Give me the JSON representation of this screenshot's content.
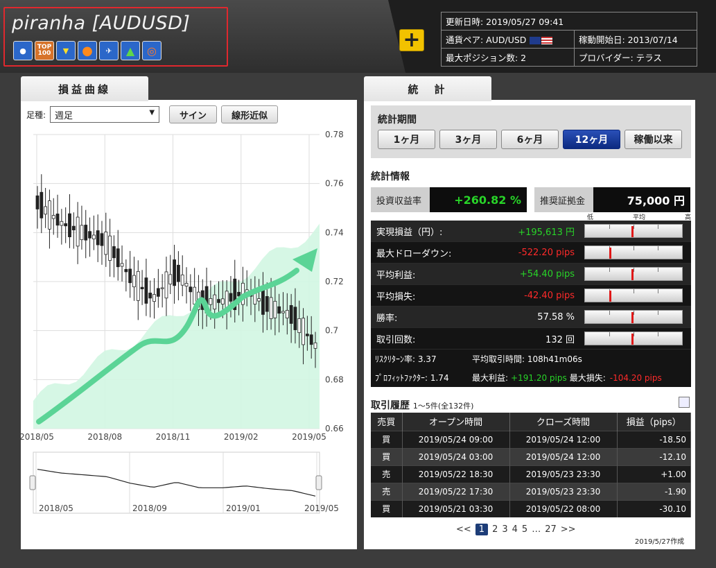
{
  "header": {
    "title": "piranha [AUDUSD]",
    "badges": [
      "beginner-icon",
      "top100-icon",
      "wakaba-icon",
      "orange-ball-icon",
      "runner-icon",
      "tree-icon",
      "target-icon"
    ],
    "top100_label": "TOP\n100",
    "plus_label": "+",
    "info": {
      "updated": "更新日時: 2019/05/27 09:41",
      "pair": "通貨ペア: AUD/USD",
      "start": "稼動開始日: 2013/07/14",
      "max_pos": "最大ポジション数: 2",
      "provider": "プロバイダー: テラス"
    }
  },
  "left_panel": {
    "tab": "損益曲線",
    "timeframe_label": "足種:",
    "timeframe_value": "週足",
    "sign_button": "サイン",
    "linear_button": "線形近似",
    "y_ticks": [
      "0.78",
      "0.76",
      "0.74",
      "0.72",
      "0.7",
      "0.68",
      "0.66"
    ],
    "x_ticks": [
      "2018/05",
      "2018/08",
      "2018/11",
      "2019/02",
      "2019/05"
    ],
    "nav_ticks": [
      "2018/05",
      "2018/09",
      "2019/01",
      "2019/05"
    ]
  },
  "chart_data": {
    "type": "line",
    "ylim": [
      0.66,
      0.78
    ],
    "series": [
      {
        "name": "",
        "x": [
          "2018/05",
          "2018/06",
          "2018/07",
          "2018/08",
          "2018/09",
          "2018/10",
          "2018/11",
          "2018/12",
          "2019/01",
          "2019/02",
          "2019/03",
          "2019/04",
          "2019/05"
        ],
        "values": [
          0.752,
          0.744,
          0.74,
          0.736,
          0.722,
          0.713,
          0.724,
          0.712,
          0.712,
          0.716,
          0.71,
          0.706,
          0.694
        ]
      }
    ]
  },
  "right_panel": {
    "tab": "統　計",
    "period_label": "統計期間",
    "periods": [
      "1ヶ月",
      "3ヶ月",
      "6ヶ月",
      "12ヶ月",
      "稼働以来"
    ],
    "stats_title": "統計情報",
    "roi_label": "投資収益率",
    "roi_value": "+260.82 %",
    "margin_label": "推奨証拠金",
    "margin_value": "75,000 円",
    "scale": {
      "low": "低",
      "avg": "平均",
      "high": "高"
    },
    "rows": [
      {
        "label": "実現損益（円）:",
        "value": "+195,613 円",
        "color": "g",
        "gauge": 0.48
      },
      {
        "label": "最大ドローダウン:",
        "value": "-522.20 pips",
        "color": "r",
        "gauge": 0.25
      },
      {
        "label": "平均利益:",
        "value": "+54.40 pips",
        "color": "g",
        "gauge": 0.48
      },
      {
        "label": "平均損失:",
        "value": "-42.40 pips",
        "color": "r",
        "gauge": 0.25
      },
      {
        "label": "勝率:",
        "value": "57.58 %",
        "color": "w",
        "gauge": 0.48
      },
      {
        "label": "取引回数:",
        "value": "132 回",
        "color": "w",
        "gauge": 0.48
      }
    ],
    "mini1": {
      "risk_label": "ﾘｽｸﾘﾀｰﾝ率: 3.37",
      "avg_time_label": "平均取引時間: 108h41m06s"
    },
    "mini2": {
      "pf_label": "ﾌﾟﾛﾌｨｯﾄﾌｧｸﾀｰ: 1.74",
      "max_profit_label": "最大利益:",
      "max_profit_value": "+191.20 pips",
      "max_loss_label": "最大損失:",
      "max_loss_value": "-104.20 pips"
    },
    "history_title": "取引履歴",
    "history_sub": "1～5件(全132件)",
    "history_headers": [
      "売買",
      "オープン時間",
      "クローズ時間",
      "損益（pips）"
    ],
    "history": [
      {
        "side": "買",
        "open": "2019/05/24 09:00",
        "close": "2019/05/24 12:00",
        "pl": "-18.50"
      },
      {
        "side": "買",
        "open": "2019/05/24 03:00",
        "close": "2019/05/24 12:00",
        "pl": "-12.10"
      },
      {
        "side": "売",
        "open": "2019/05/22 18:30",
        "close": "2019/05/23 23:30",
        "pl": "+1.00"
      },
      {
        "side": "売",
        "open": "2019/05/22 17:30",
        "close": "2019/05/23 23:30",
        "pl": "-1.90"
      },
      {
        "side": "買",
        "open": "2019/05/21 03:30",
        "close": "2019/05/22 08:00",
        "pl": "-30.10"
      }
    ],
    "pager": [
      "<<",
      "1",
      "2",
      "3",
      "4",
      "5",
      "…",
      "27",
      ">>"
    ],
    "created": "2019/5/27作成"
  }
}
